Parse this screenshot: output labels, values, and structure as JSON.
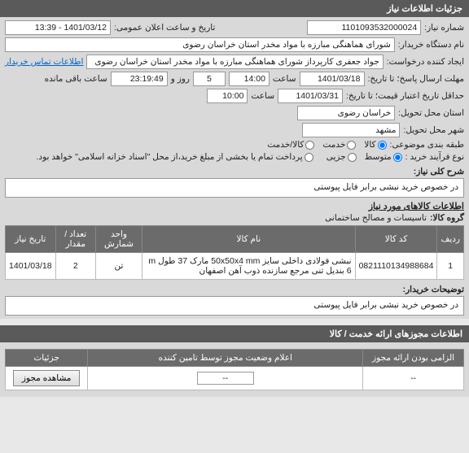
{
  "headers": {
    "details": "جزئیات اطلاعات نیاز",
    "permits": "اطلاعات مجوزهای ارائه خدمت / کالا"
  },
  "fields": {
    "need_number_label": "شماره نیاز:",
    "need_number": "1101093532000024",
    "announce_label": "تاریخ و ساعت اعلان عمومی:",
    "announce": "1401/03/12 - 13:39",
    "buyer_label": "نام دستگاه خریدار:",
    "buyer": "شورای هماهنگی مبارزه با مواد مخدر استان خراسان رضوی",
    "requester_label": "ایجاد کننده درخواست:",
    "requester": "جواد جعفری کارپرداز شورای هماهنگی مبارزه با مواد مخدر استان خراسان رضوی",
    "contact_link": "اطلاعات تماس خریدار",
    "deadline_label": "مهلت ارسال پاسخ؛ تا تاریخ:",
    "deadline_date": "1401/03/18",
    "time_label": "ساعت",
    "deadline_time": "14:00",
    "days_between": "5",
    "days_label": "روز و",
    "remaining_time": "23:19:49",
    "remaining_label": "ساعت باقی مانده",
    "validity_label": "حداقل تاریخ اعتبار قیمت؛ تا تاریخ:",
    "validity_date": "1401/03/31",
    "validity_time": "10:00",
    "province_label": "استان محل تحویل:",
    "province": "خراسان رضوی",
    "city_label": "شهر محل تحویل:",
    "city": "مشهد",
    "category_label": "طبقه بندی موضوعی:",
    "cat_kala": "کالا",
    "cat_khadamat": "خدمت",
    "cat_both": "کالا/خدمت",
    "process_label": "نوع فرآیند خرید :",
    "proc_mid": "متوسط",
    "proc_small": "جزیی",
    "payment_note": "پرداخت تمام یا بخشی از مبلغ خرید،از محل \"اسناد خزانه اسلامی\" خواهد بود.",
    "desc_label": "شرح کلی نیاز:",
    "desc_text": "در خصوص خرید نبشی برابر فایل پیوستی",
    "items_header": "اطلاعات کالاهای مورد نیاز",
    "group_label": "گروه کالا:",
    "group_value": "تاسیسات و مصالح ساختمانی",
    "buyer_notes_label": "توضیحات خریدار:",
    "buyer_notes": "در خصوص خرید نبشی برابر فایل پیوستی"
  },
  "table": {
    "cols": {
      "row": "ردیف",
      "code": "کد کالا",
      "name": "نام کالا",
      "unit": "واحد شمارش",
      "qty": "تعداد / مقدار",
      "date": "تاریخ نیاز"
    },
    "rows": [
      {
        "row": "1",
        "code": "0821110134988684",
        "name": "نبشی فولادی داخلی سایز 50x50x4 mm مارک 37 طول m 6 بنديل تنی مرجع سازنده ذوب آهن اصفهان",
        "unit": "تن",
        "qty": "2",
        "date": "1401/03/18"
      }
    ]
  },
  "permits_table": {
    "cols": {
      "mandatory": "الزامی بودن ارائه مجوز",
      "status": "اعلام وضعیت مجوز توسط تامین کننده",
      "details": "جزئیات"
    },
    "dash": "--",
    "view_btn": "مشاهده مجوز"
  }
}
